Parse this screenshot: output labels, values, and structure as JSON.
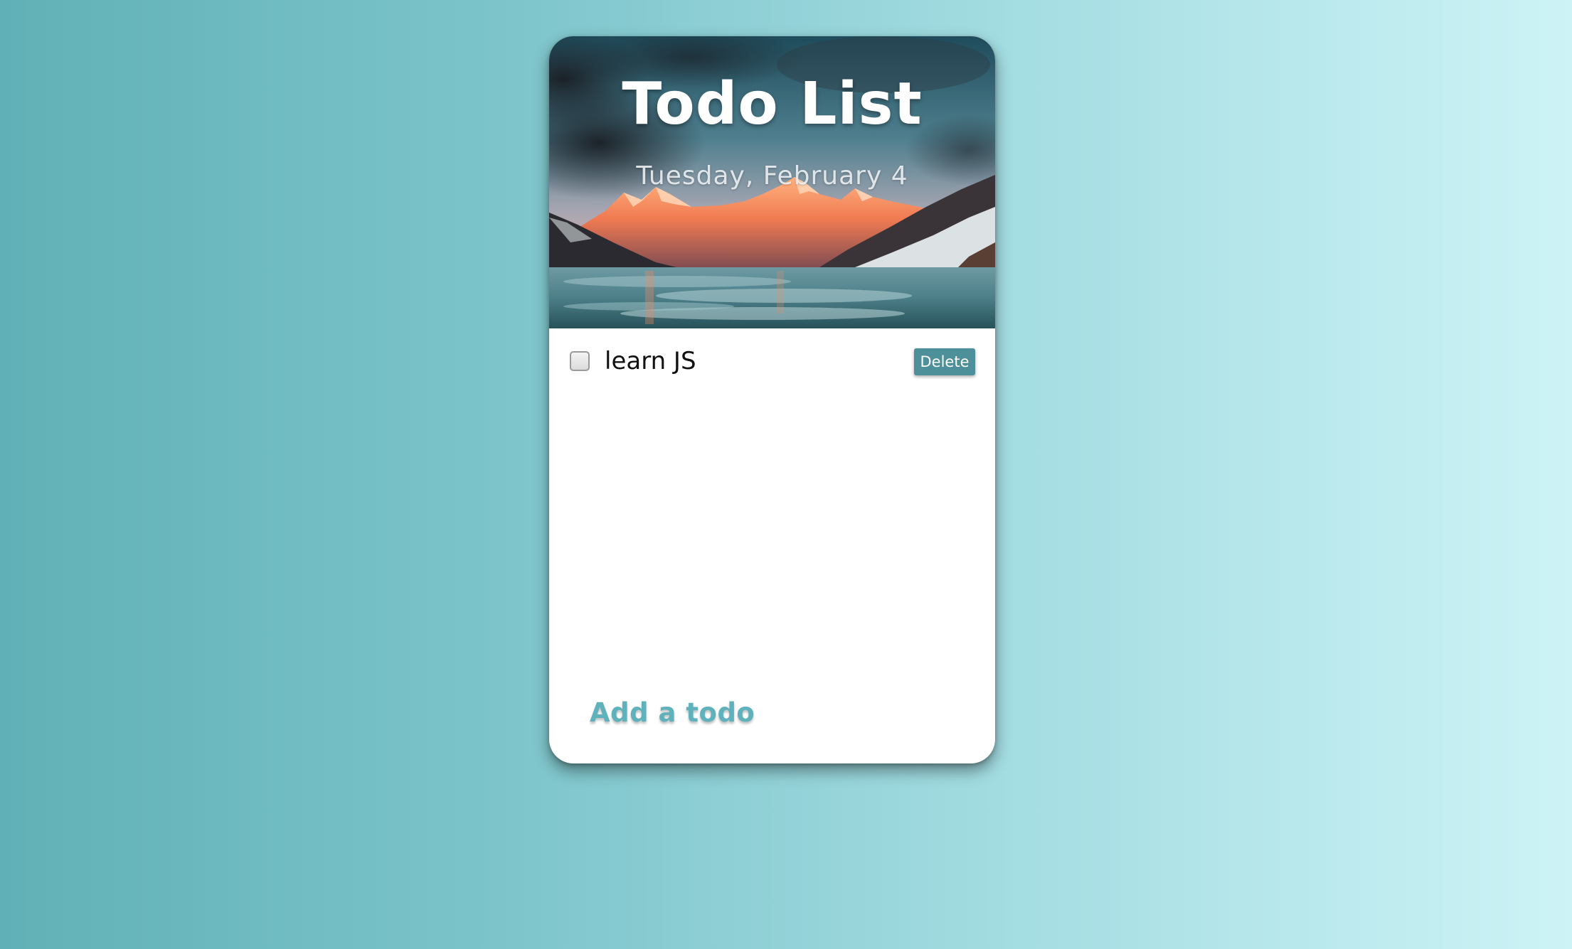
{
  "app": {
    "title": "Todo List",
    "date": "Tuesday, February 4"
  },
  "todos": [
    {
      "text": "learn JS",
      "completed": false,
      "delete_label": "Delete"
    }
  ],
  "add_todo": {
    "label": "Add a todo"
  },
  "colors": {
    "accent": "#4e909a",
    "add_text": "#5fb2bc",
    "background_left": "#60b1b7",
    "background_right": "#cdf3f6"
  }
}
